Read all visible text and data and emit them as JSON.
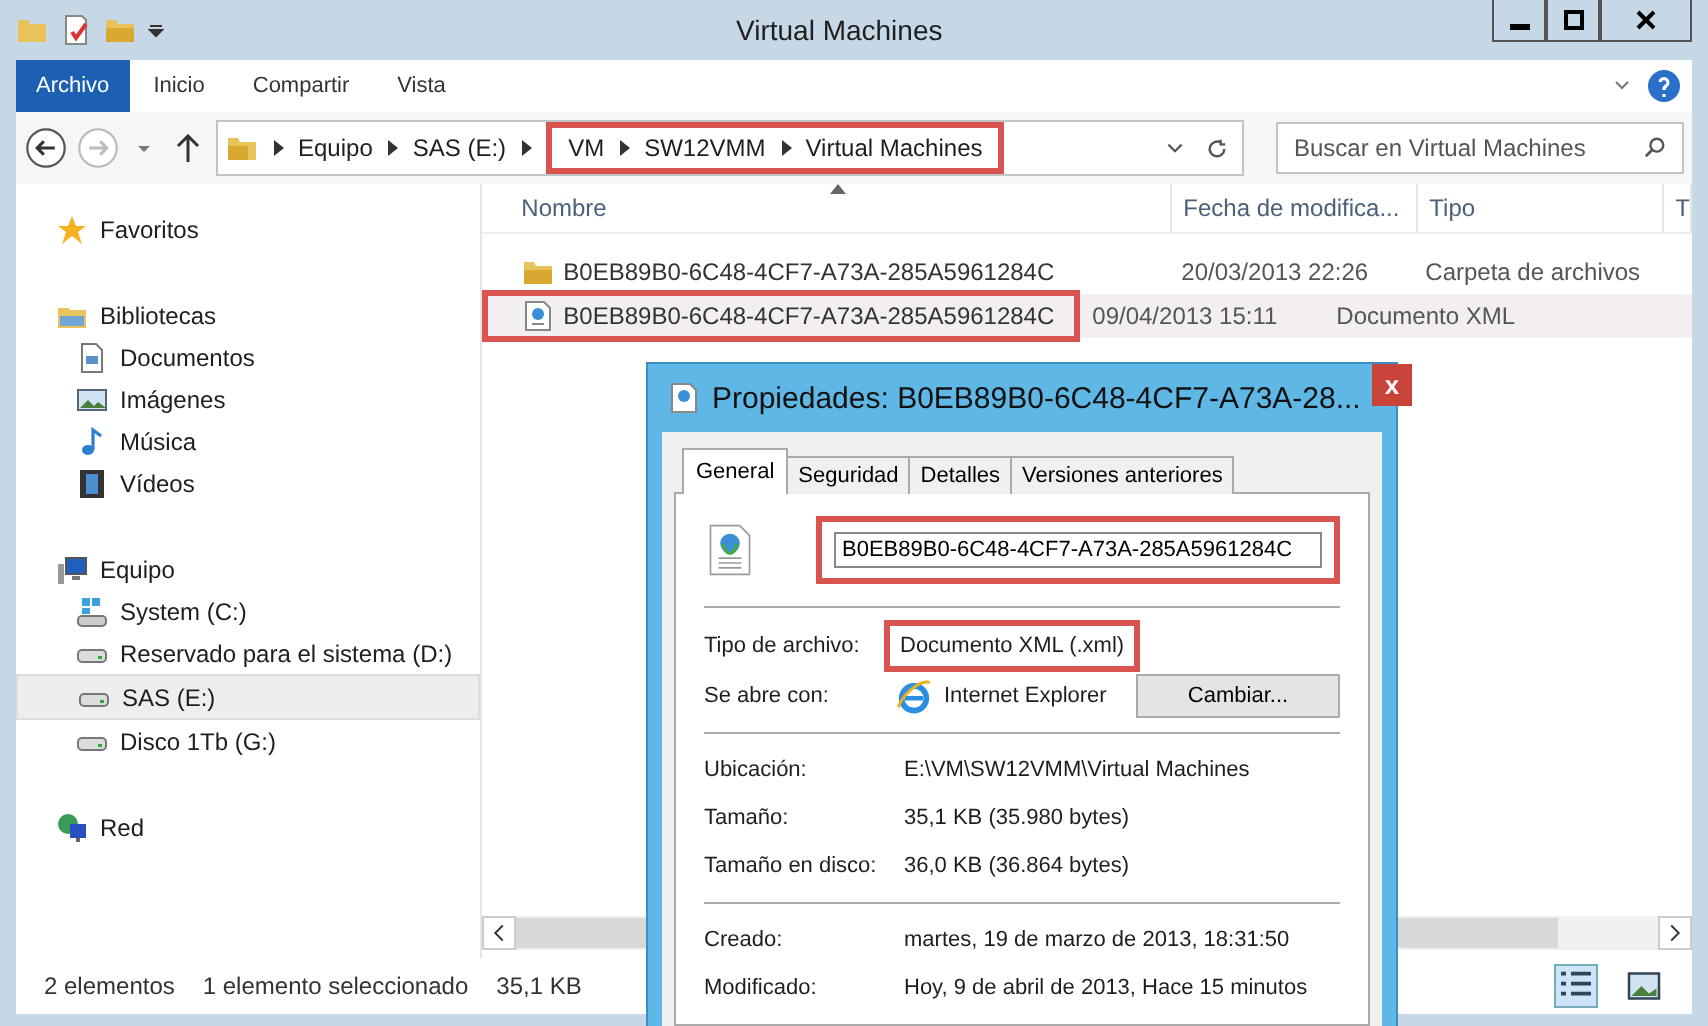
{
  "window": {
    "title": "Virtual Machines"
  },
  "ribbon_tabs": [
    {
      "label": "Archivo",
      "kind": "file"
    },
    {
      "label": "Inicio",
      "kind": "tab"
    },
    {
      "label": "Compartir",
      "kind": "tab"
    },
    {
      "label": "Vista",
      "kind": "tab"
    }
  ],
  "address": {
    "crumbs": [
      {
        "label": "Equipo",
        "highlighted": false
      },
      {
        "label": "SAS (E:)",
        "highlighted": false
      },
      {
        "label": "VM",
        "highlighted": true
      },
      {
        "label": "SW12VMM",
        "highlighted": true
      },
      {
        "label": "Virtual Machines",
        "highlighted": true
      }
    ]
  },
  "search": {
    "placeholder": "Buscar en Virtual Machines"
  },
  "sidebar": {
    "groups": [
      {
        "label": "Favoritos",
        "kind": "star"
      },
      {
        "label": "Bibliotecas",
        "kind": "library",
        "children": [
          {
            "label": "Documentos",
            "kind": "doc",
            "selected": false
          },
          {
            "label": "Imágenes",
            "kind": "image",
            "selected": false
          },
          {
            "label": "Música",
            "kind": "music",
            "selected": false
          },
          {
            "label": "Vídeos",
            "kind": "video",
            "selected": false
          }
        ]
      },
      {
        "label": "Equipo",
        "kind": "computer",
        "children": [
          {
            "label": "System (C:)",
            "kind": "sysdrive",
            "selected": false
          },
          {
            "label": "Reservado para el sistema (D:)",
            "kind": "drive",
            "selected": false
          },
          {
            "label": "SAS (E:)",
            "kind": "drive",
            "selected": true
          },
          {
            "label": "Disco 1Tb (G:)",
            "kind": "drive",
            "selected": false
          }
        ]
      },
      {
        "label": "Red",
        "kind": "network"
      }
    ]
  },
  "table": {
    "columns": [
      "Nombre",
      "Fecha de modifica...",
      "Tipo",
      "T"
    ],
    "rows": [
      {
        "name": "B0EB89B0-6C48-4CF7-A73A-285A5961284C",
        "date": "20/03/2013 22:26",
        "type": "Carpeta de archivos",
        "kind": "folder",
        "selected": false,
        "highlighted": false
      },
      {
        "name": "B0EB89B0-6C48-4CF7-A73A-285A5961284C",
        "date": "09/04/2013 15:11",
        "type": "Documento XML",
        "kind": "xml",
        "selected": true,
        "highlighted": true
      }
    ]
  },
  "status_bar": {
    "count": "2 elementos",
    "selection": "1 elemento seleccionado",
    "size": "35,1 KB"
  },
  "dialog": {
    "title": "Propiedades: B0EB89B0-6C48-4CF7-A73A-28...",
    "close": "x",
    "tabs": [
      {
        "label": "General",
        "selected": true
      },
      {
        "label": "Seguridad",
        "selected": false
      },
      {
        "label": "Detalles",
        "selected": false
      },
      {
        "label": "Versiones anteriores",
        "selected": false
      }
    ],
    "name_field": {
      "value": "B0EB89B0-6C48-4CF7-A73A-285A5961284C",
      "highlighted": true
    },
    "file_type": {
      "label": "Tipo de archivo:",
      "value": "Documento XML (.xml)",
      "highlighted": true
    },
    "opens_with": {
      "label": "Se abre con:",
      "value": "Internet Explorer",
      "button": "Cambiar..."
    },
    "sections": [
      [
        {
          "label": "Ubicación:",
          "value": "E:\\VM\\SW12VMM\\Virtual Machines"
        },
        {
          "label": "Tamaño:",
          "value": "35,1 KB (35.980 bytes)"
        },
        {
          "label": "Tamaño en disco:",
          "value": "36,0 KB (36.864 bytes)"
        }
      ],
      [
        {
          "label": "Creado:",
          "value": "martes, 19 de marzo de 2013, 18:31:50"
        },
        {
          "label": "Modificado:",
          "value": "Hoy, 9 de abril de 2013, Hace 15 minutos"
        }
      ]
    ]
  }
}
